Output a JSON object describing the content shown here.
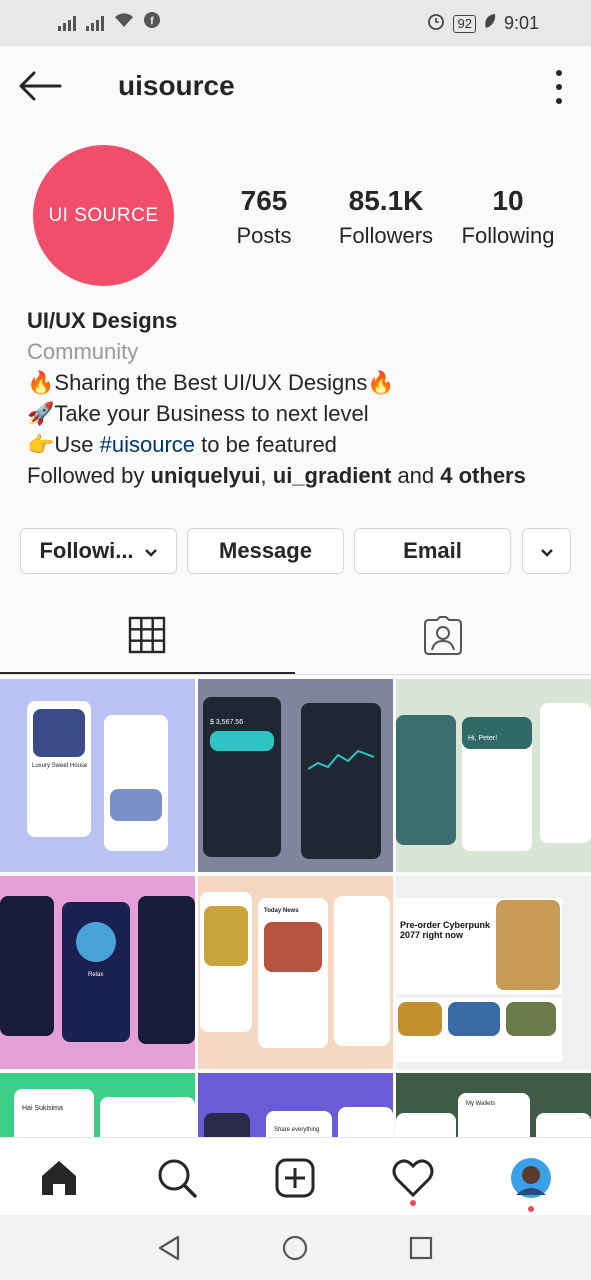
{
  "status": {
    "time": "9:01",
    "battery": "92"
  },
  "header": {
    "username": "uisource"
  },
  "profile": {
    "avatar_text": "UI SOURCE",
    "stats": [
      {
        "value": "765",
        "label": "Posts"
      },
      {
        "value": "85.1K",
        "label": "Followers"
      },
      {
        "value": "10",
        "label": "Following"
      }
    ],
    "name": "UI/UX Designs",
    "category": "Community",
    "bio_line1": "🔥Sharing the Best UI/UX Designs🔥",
    "bio_line2": "🚀Take your Business to next level",
    "bio_line3_pre": "👉Use ",
    "bio_hashtag": "#uisource",
    "bio_line3_post": " to be featured",
    "followed_by_pre": "Followed by ",
    "followed_user1": "uniquelyui",
    "followed_sep": ", ",
    "followed_user2": "ui_gradient",
    "followed_and": " and ",
    "followed_others": "4 others"
  },
  "actions": {
    "following": "Followi...",
    "message": "Message",
    "email": "Email"
  },
  "colors": {
    "avatar": "#f04e6a",
    "hashtag": "#00376b",
    "notification_dot": "#ed4956"
  },
  "grid_posts": [
    {
      "text": "Luxury Sweet House"
    },
    {
      "text": "$ 3,567.56"
    },
    {
      "text": "Hi, Peter!"
    },
    {
      "text": "Relax"
    },
    {
      "text": "Today News"
    },
    {
      "text": "Pre-order Cyberpunk 2077 right now"
    },
    {
      "text": "Hai Sukisima"
    },
    {
      "text": "Share everything"
    },
    {
      "text": "My Wallets"
    }
  ]
}
